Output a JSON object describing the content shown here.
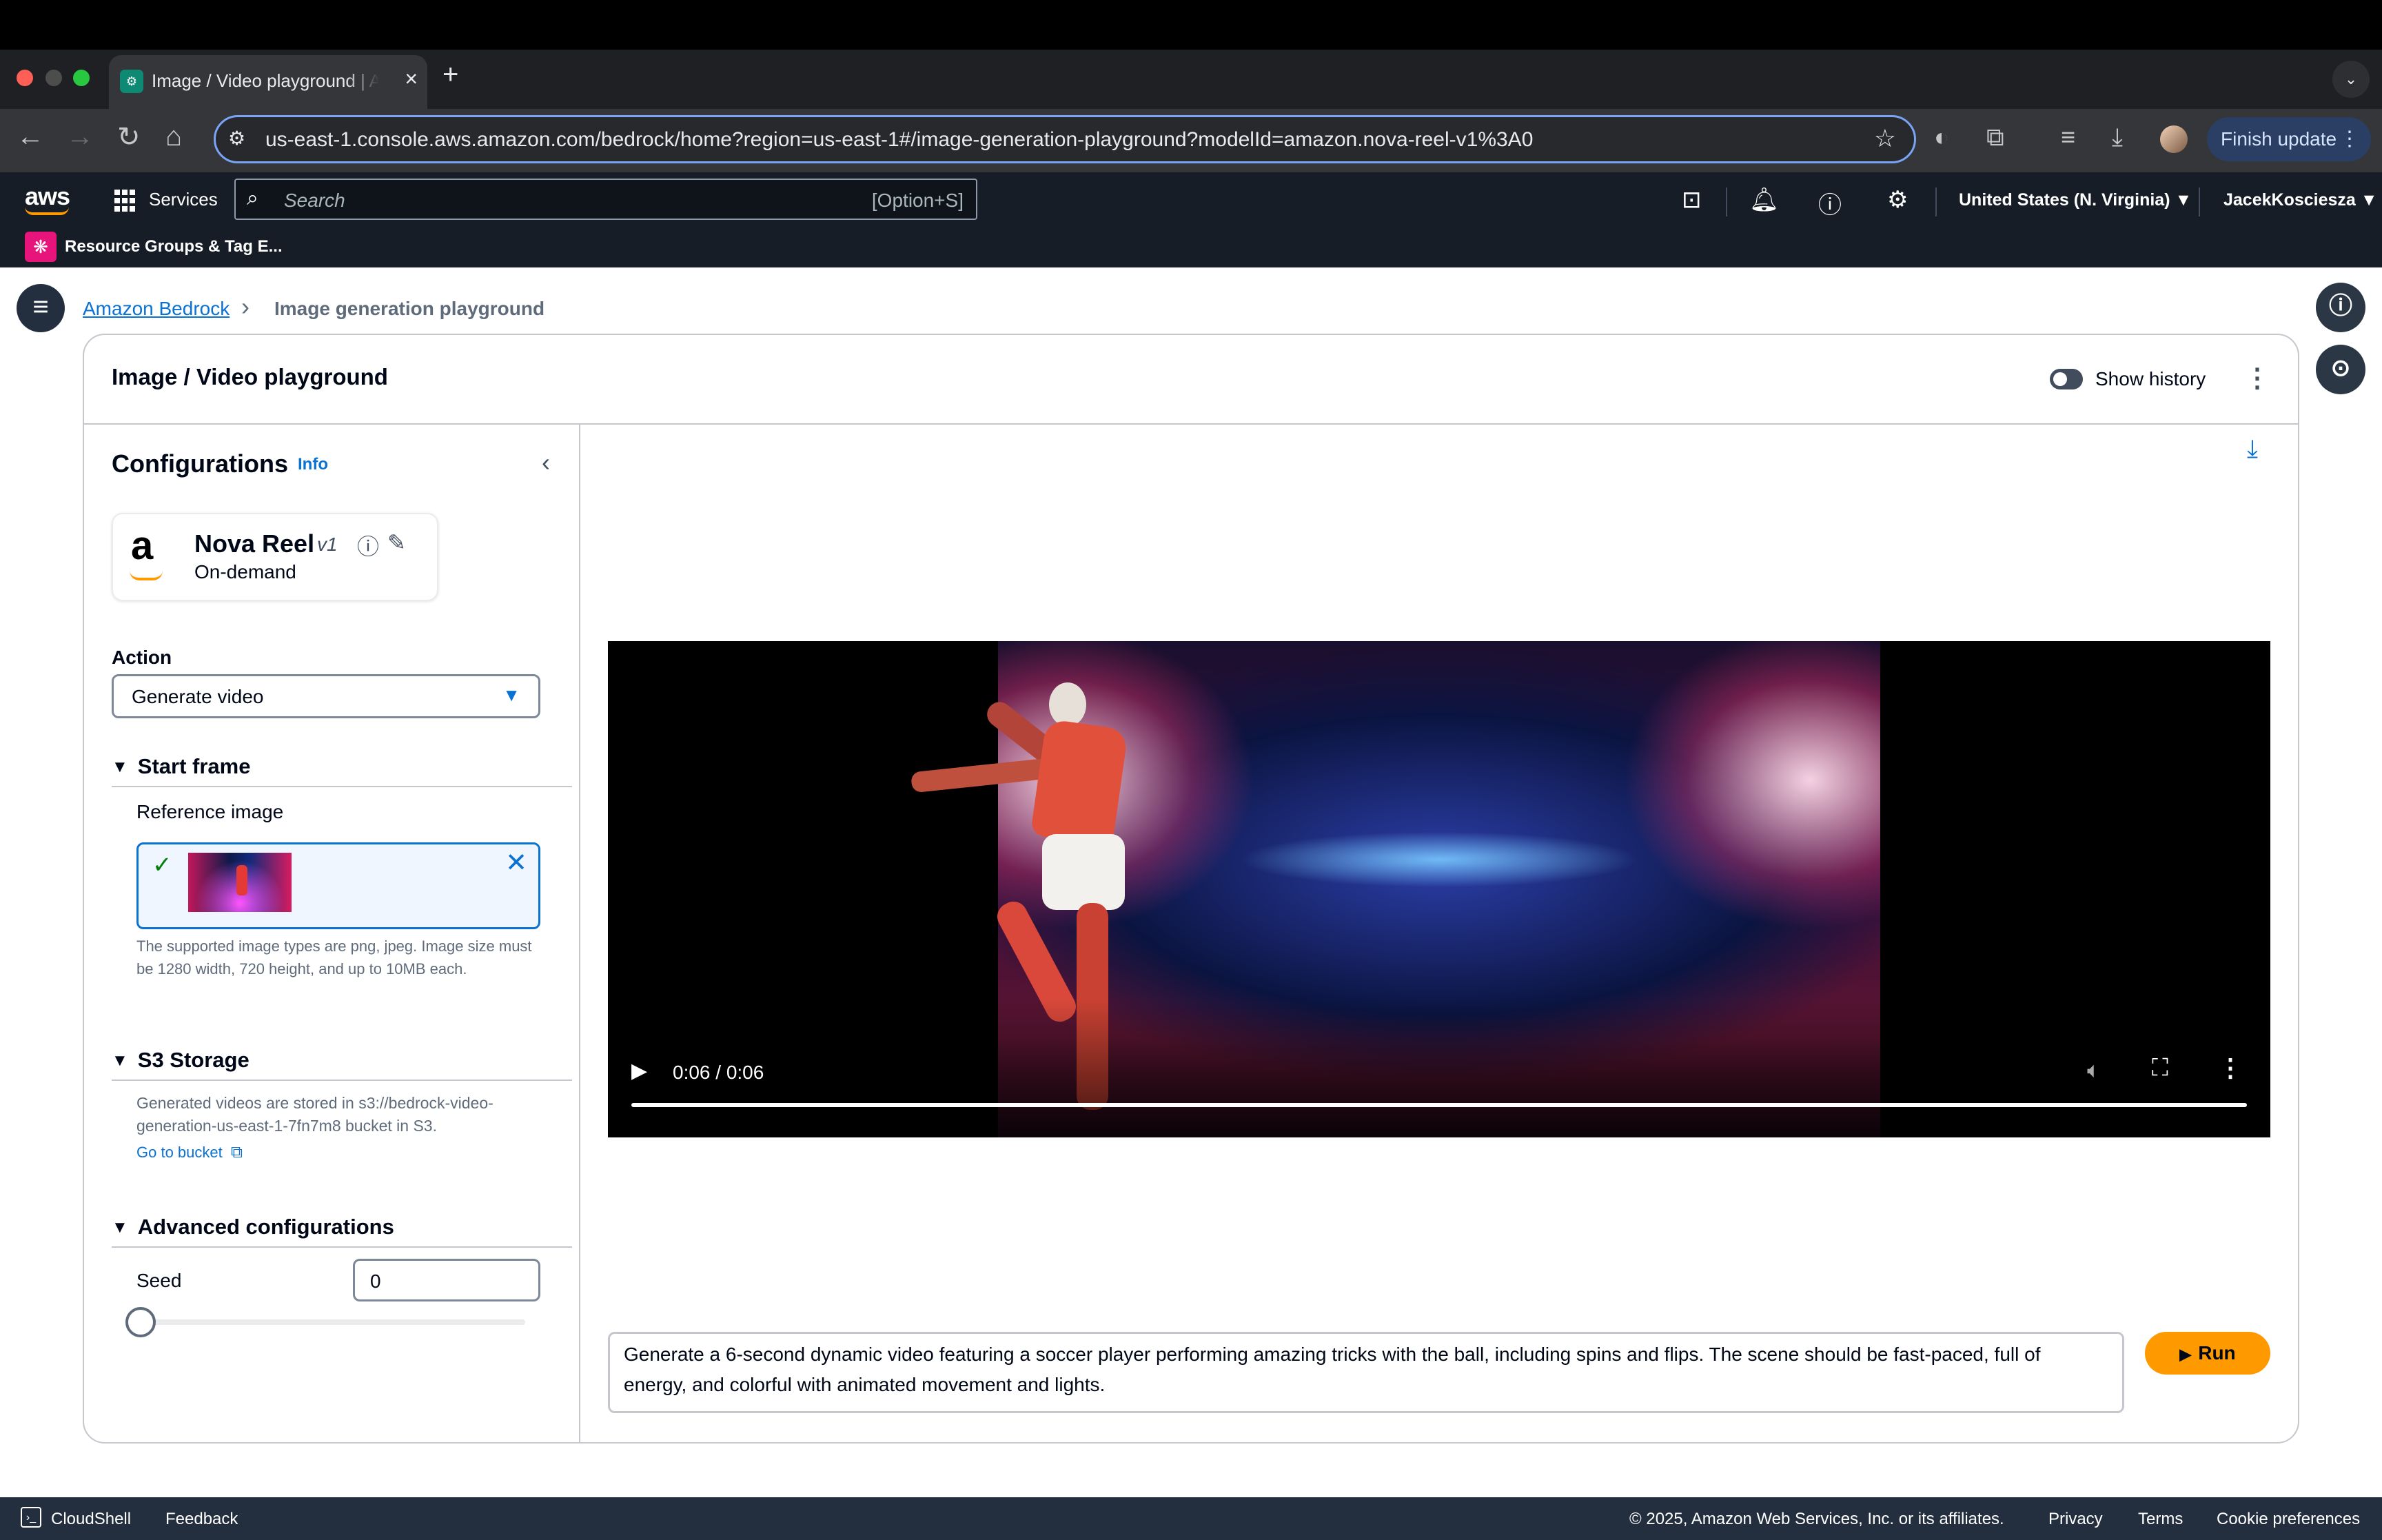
{
  "browser": {
    "tab_title": "Image / Video playground | Amazon Bedrock",
    "url": "us-east-1.console.aws.amazon.com/bedrock/home?region=us-east-1#/image-generation-playground?modelId=amazon.nova-reel-v1%3A0",
    "finish_update": "Finish update"
  },
  "aws_header": {
    "logo": "aws",
    "services": "Services",
    "search_placeholder": "Search",
    "search_shortcut": "[Option+S]",
    "region": "United States (N. Virginia) ▼",
    "user": "JacekKoscieszа ▼",
    "favorite": "Resource Groups & Tag E..."
  },
  "breadcrumb": {
    "root": "Amazon Bedrock",
    "current": "Image generation playground"
  },
  "card": {
    "title": "Image / Video playground",
    "show_history": "Show history"
  },
  "config": {
    "title": "Configurations",
    "info": "Info",
    "model": {
      "name": "Nova Reel",
      "version": "v1",
      "mode": "On-demand"
    },
    "action_label": "Action",
    "action_value": "Generate video",
    "start_frame": {
      "header": "Start frame",
      "ref_label": "Reference image",
      "help": "The supported image types are png, jpeg. Image size must be 1280 width, 720 height, and up to 10MB each."
    },
    "s3": {
      "header": "S3 Storage",
      "text": "Generated videos are stored in s3://bedrock-video-generation-us-east-1-7fn7m8 bucket in S3.",
      "link": "Go to bucket"
    },
    "advanced": {
      "header": "Advanced configurations",
      "seed_label": "Seed",
      "seed_value": "0",
      "seed_slider_fraction": 0
    }
  },
  "video": {
    "time": "0:06 / 0:06",
    "progress_fraction": 1.0
  },
  "prompt": {
    "text": "Generate a 6-second dynamic video featuring a soccer player performing amazing tricks with the ball, including spins and flips. The scene should be fast-paced, full of energy, and colorful with animated movement and lights.",
    "run_label": "Run"
  },
  "footer": {
    "cloudshell": "CloudShell",
    "feedback": "Feedback",
    "copyright": "© 2025, Amazon Web Services, Inc. or its affiliates.",
    "privacy": "Privacy",
    "terms": "Terms",
    "cookies": "Cookie preferences"
  },
  "colors": {
    "aws_header": "#161d26",
    "link_blue": "#0972d3",
    "run_orange": "#ff9900"
  }
}
